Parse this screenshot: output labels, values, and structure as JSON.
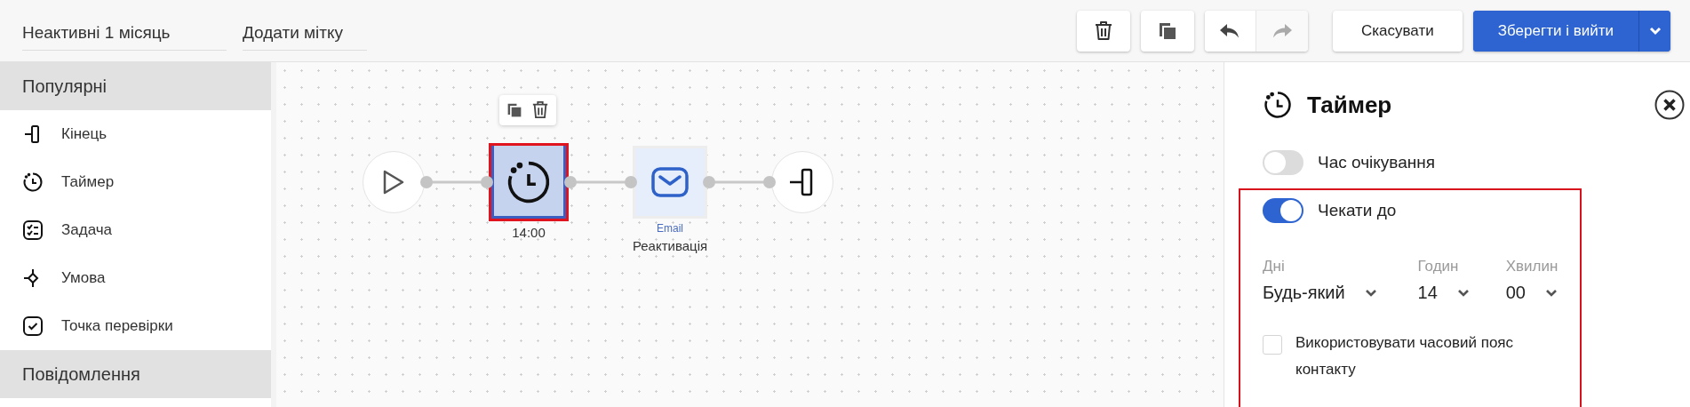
{
  "header": {
    "title": "Неактивні 1 місяць",
    "tag_field": {
      "placeholder": "Додати мітку"
    },
    "redo_disabled": true,
    "cancel_label": "Скасувати",
    "save_label": "Зберегти і вийти"
  },
  "sidebar": {
    "groups": [
      {
        "title": "Популярні",
        "items": [
          {
            "label": "Кінець",
            "kind": "end"
          },
          {
            "label": "Таймер",
            "kind": "timer"
          },
          {
            "label": "Задача",
            "kind": "task"
          },
          {
            "label": "Умова",
            "kind": "condition"
          },
          {
            "label": "Точка перевірки",
            "kind": "checkpoint"
          }
        ]
      },
      {
        "title": "Повідомлення"
      }
    ]
  },
  "canvas": {
    "nodes": [
      {
        "kind": "start"
      },
      {
        "kind": "timer",
        "caption": "14:00",
        "selected": true
      },
      {
        "kind": "email",
        "type_label": "Email",
        "caption": "Реактивація",
        "selected": false
      },
      {
        "kind": "end"
      }
    ]
  },
  "panel": {
    "title": "Таймер",
    "wait_duration": {
      "label": "Час очікування",
      "on": false
    },
    "wait_until": {
      "label": "Чекати до",
      "on": true,
      "highlighted": true,
      "fields": [
        {
          "label": "Дні",
          "value": "Будь-який"
        },
        {
          "label": "Годин",
          "value": "14"
        },
        {
          "label": "Хвилин",
          "value": "00"
        }
      ],
      "timezone": {
        "label": "Використовувати часовий пояс контакту",
        "checked": false
      }
    }
  }
}
